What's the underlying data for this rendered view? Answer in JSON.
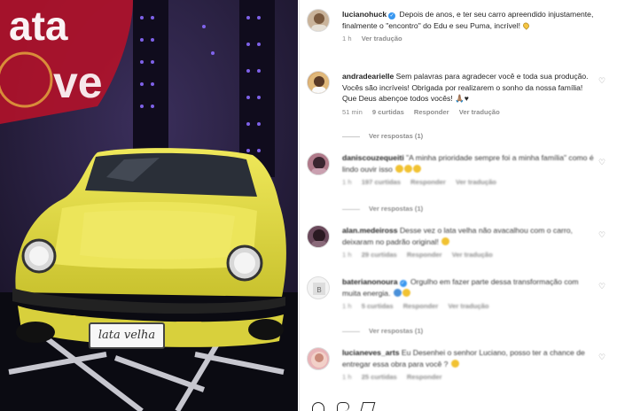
{
  "photo": {
    "sign_text": "lata velha",
    "colors": {
      "car": "#e7e04a",
      "car_shade": "#b9b12a",
      "backdrop": "#241c3d",
      "stage": "#0b0b12"
    }
  },
  "caption": {
    "username": "lucianohuck",
    "text": "Depois de anos, e ter seu carro apreendido injustamente, finalmente o \"encontro\" do Edu e seu Puma, incrível!",
    "time": "1 h",
    "translate": "Ver tradução"
  },
  "comments": [
    {
      "username": "andradearielle",
      "text": "Sem palavras para agradecer você e toda sua produção. Vocês são incríveis! Obrigada por realizarem o sonho da nossa família! Que Deus abençoe todos vocês! 🙏🏽♥",
      "time": "51 min",
      "likes": "9 curtidas",
      "reply": "Responder",
      "translate": "Ver tradução",
      "view_replies": "Ver respostas (1)"
    },
    {
      "username": "daniscouzequeiti",
      "text": "\"A minha prioridade sempre foi a minha família\" como é lindo ouvir isso",
      "time": "1 h",
      "likes": "197 curtidas",
      "reply": "Responder",
      "translate": "Ver tradução",
      "view_replies": "Ver respostas (1)"
    },
    {
      "username": "alan.medeiross",
      "text": "Desse vez o lata velha não avacalhou com o carro, deixaram no padrão original!",
      "time": "1 h",
      "likes": "29 curtidas",
      "reply": "Responder",
      "translate": "Ver tradução"
    },
    {
      "username": "baterianonoura",
      "text": "Orgulho em fazer parte dessa transformação com muita energia.",
      "time": "1 h",
      "likes": "5 curtidas",
      "reply": "Responder",
      "translate": "Ver tradução",
      "view_replies": "Ver respostas (1)"
    },
    {
      "username": "lucianeves_arts",
      "text": "Eu Desenhei o senhor Luciano, posso ter a chance de entregar essa obra para você ?",
      "time": "1 h",
      "likes": "25 curtidas",
      "reply": "Responder",
      "translate": "Ver tradução"
    }
  ]
}
